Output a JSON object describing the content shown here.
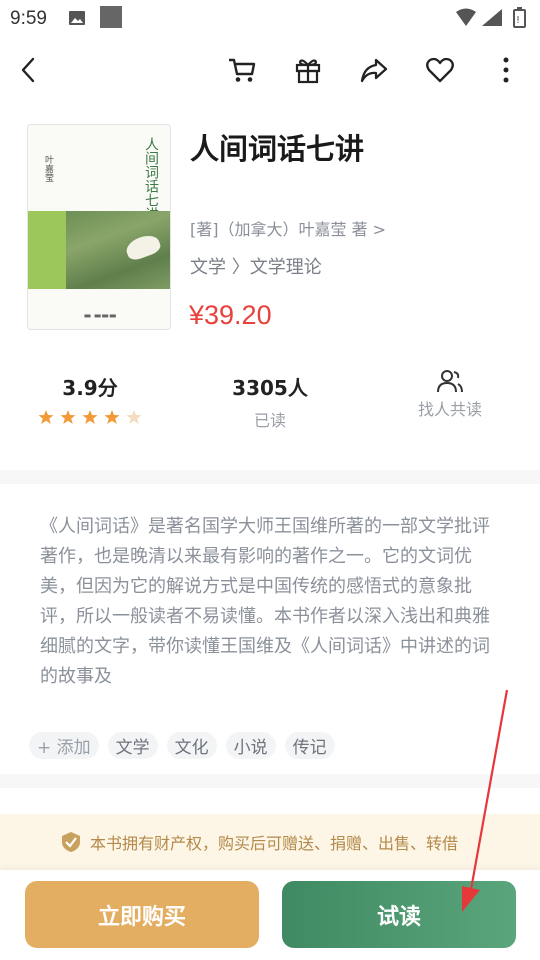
{
  "status_bar": {
    "time": "9:59"
  },
  "nav": {
    "back_icon": "back-icon",
    "cart_icon": "cart-icon",
    "gift_icon": "gift-icon",
    "share_icon": "share-icon",
    "favorite_icon": "heart-icon",
    "more_icon": "more-icon"
  },
  "book": {
    "title": "人间词话七讲",
    "author": "[著]（加拿大）叶嘉莹 著 >",
    "category": "文学 〉文学理论",
    "price": "¥39.20",
    "cover": {
      "title": "人间词话七讲",
      "author": "叶嘉莹"
    }
  },
  "stats": {
    "rating": "3.9分",
    "stars": 3.9,
    "readers": "3305人",
    "readers_label": "已读",
    "find_label": "找人共读"
  },
  "description": "《人间词话》是著名国学大师王国维所著的一部文学批评著作，也是晚清以来最有影响的著作之一。它的文词优美，但因为它的解说方式是中国传统的感悟式的意象批评，所以一般读者不易读懂。本书作者以深入浅出和典雅细腻的文字，带你读懂王国维及《人间词话》中讲述的词的故事及",
  "tags": {
    "add_label": "+ 添加",
    "items": [
      "文学",
      "文化",
      "小说",
      "传记"
    ]
  },
  "notice": "本书拥有财产权，购买后可赠送、捐赠、出售、转借",
  "actions": {
    "buy_label": "立即购买",
    "trial_label": "试读"
  },
  "colors": {
    "price": "#e8403a",
    "buy": "#e3ae62",
    "trial": "#4a9670",
    "star": "#f29a38",
    "annotation_arrow": "#e5383b"
  }
}
